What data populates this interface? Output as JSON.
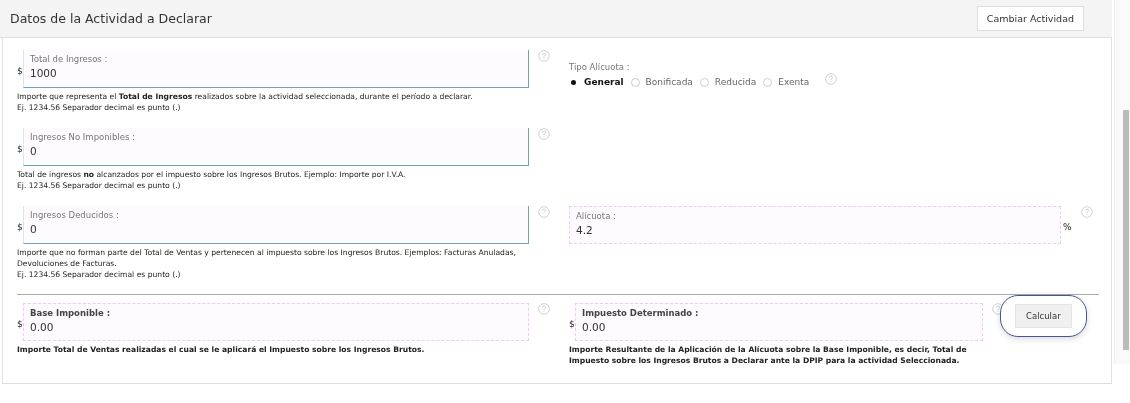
{
  "header": {
    "title": "Datos de la Actividad a Declarar",
    "button": "Cambiar Actividad"
  },
  "rows": [
    {
      "left": {
        "kind": "input",
        "prefix": "$",
        "label": "Total de Ingresos :",
        "value": "1000",
        "help": [
          "Importe que representa el **Total de Ingresos** realizados sobre la actividad seleccionada, durante el período a declarar.",
          "Ej. 1234.56 Separador decimal es punto (.)"
        ]
      },
      "right": {
        "kind": "radios",
        "label": "Tipo Alícuota :",
        "options": [
          {
            "label": "General",
            "selected": true
          },
          {
            "label": "Bonificada",
            "selected": false
          },
          {
            "label": "Reducida",
            "selected": false
          },
          {
            "label": "Exenta",
            "selected": false
          }
        ]
      }
    },
    {
      "left": {
        "kind": "input",
        "prefix": "$",
        "label": "Ingresos No Imponibles :",
        "value": "0",
        "help": [
          "Total de ingresos **no** alcanzados por el impuesto sobre los Ingresos Brutos. Ejemplo: Importe por I.V.A.",
          "Ej. 1234.56 Separador decimal es punto (.)"
        ]
      }
    },
    {
      "left": {
        "kind": "input",
        "prefix": "$",
        "label": "Ingresos Deducidos :",
        "value": "0",
        "help": [
          "Importe que no forman parte del Total de Ventas y pertenecen al impuesto sobre los Ingresos Brutos. Ejemplos: Facturas Anuladas, Devoluciones de Facturas.",
          "Ej. 1234.56 Separador decimal es punto (.)"
        ]
      },
      "right": {
        "kind": "readonly",
        "label": "Alícuota :",
        "value": "4.2",
        "suffix": "%"
      }
    }
  ],
  "totals": [
    {
      "kind": "readonly",
      "prefix": "$",
      "label": "Base Imponible :",
      "value": "0.00",
      "help": [
        "Importe Total de Ventas realizadas el cual se le aplicará el Impuesto sobre los Ingresos Brutos."
      ]
    },
    {
      "kind": "readonly",
      "prefix": "$",
      "label": "Impuesto Determinado :",
      "value": "0.00",
      "help": [
        "Importe Resultante de la Aplicación de la Alícuota sobre la Base Imponible, es decir, Total de Impuesto sobre los Ingresos Brutos a Declarar ante la DPIP para la actividad Seleccionada."
      ],
      "button": "Calcular"
    }
  ]
}
